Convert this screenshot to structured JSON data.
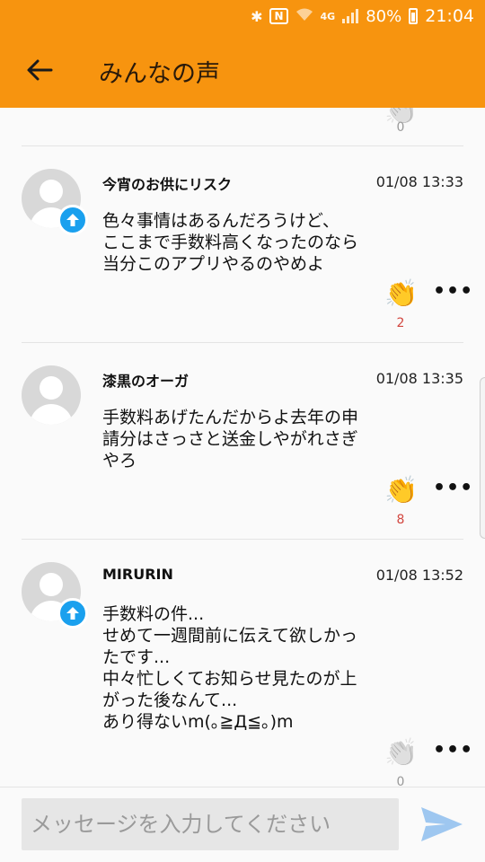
{
  "status_bar": {
    "battery": "80%",
    "time": "21:04",
    "network": "4G"
  },
  "header": {
    "title": "みんなの声"
  },
  "top_partial": {
    "clap_count": "0"
  },
  "messages": [
    {
      "username": "今宵のお供にリスク",
      "timestamp": "01/08 13:33",
      "body": "色々事情はあるんだろうけど、\nここまで手数料高くなったのなら\n当分このアプリやるのやめよ",
      "claps": "2",
      "upvoted": true
    },
    {
      "username": "漆黒のオーガ",
      "timestamp": "01/08 13:35",
      "body": "手数料あげたんだからよ去年の申\n請分はさっさと送金しやがれさぎ\nやろ",
      "claps": "8",
      "upvoted": false
    },
    {
      "username": "MIRURIN",
      "timestamp": "01/08 13:52",
      "body": "手数料の件...\nせめて一週間前に伝えて欲しかっ\nたです...\n中々忙しくてお知らせ見たのが上\nがった後なんて...\nあり得ないm(｡≧Д≦｡)m",
      "claps": "0",
      "upvoted": true
    }
  ],
  "composer": {
    "placeholder": "メッセージを入力してください"
  },
  "colors": {
    "accent": "#f7940f",
    "badge": "#1aa0ee",
    "send": "#9ec7f0",
    "clap_count": "#d2463f"
  }
}
